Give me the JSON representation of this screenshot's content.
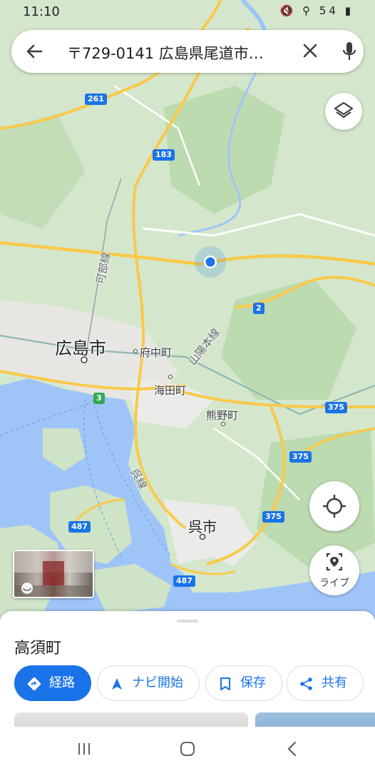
{
  "status_bar": {
    "time": "11:10",
    "icons": "🔇 ⚲ 54 ▮"
  },
  "search": {
    "query": "〒729-0141 広島県尾道市…"
  },
  "map": {
    "labels": {
      "hiroshima": "広島市",
      "fuchu": "府中町",
      "kaita": "海田町",
      "kumano": "熊野町",
      "kure": "呉市",
      "kabe_line": "可部線",
      "sanyo_line": "山陽本線",
      "kure_line": "呉線"
    },
    "shields": {
      "r261": "261",
      "r183": "183",
      "r2": "2",
      "r3": "3",
      "r375a": "375",
      "r375b": "375",
      "r375c": "375",
      "r487a": "487",
      "r487b": "487"
    }
  },
  "controls": {
    "live_label": "ライブ"
  },
  "sheet": {
    "title": "高須町",
    "actions": {
      "route": "経路",
      "navigate": "ナビ開始",
      "save": "保存",
      "share": "共有"
    }
  },
  "colors": {
    "accent": "#1a73e8",
    "water": "#9fc5f8",
    "land": "#d7e8cf",
    "road": "#f9c94b"
  }
}
